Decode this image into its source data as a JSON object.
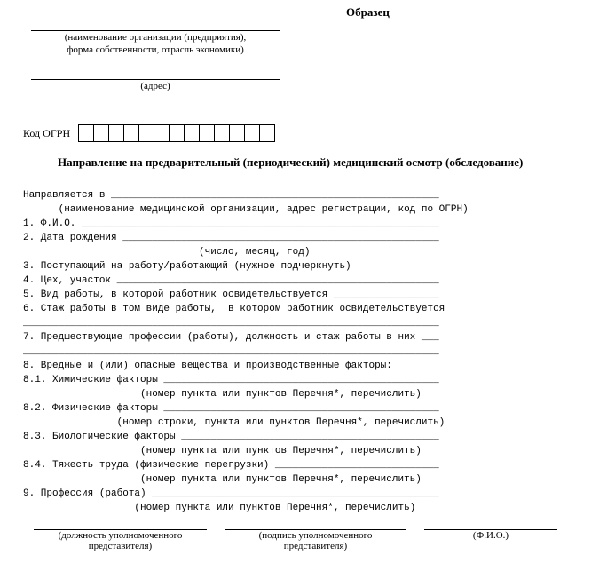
{
  "header": {
    "sample": "Образец",
    "org_caption1": "(наименование организации (предприятия),",
    "org_caption2": "форма собственности, отрасль экономики)",
    "addr_caption": "(адрес)"
  },
  "ogrn": {
    "label": "Код ОГРН",
    "cell_count": 13
  },
  "title": "Направление на предварительный (периодический) медицинский осмотр (обследование)",
  "body": "Направляется в ________________________________________________________\n      (наименование медицинской организации, адрес регистрации, код по ОГРН)\n1. Ф.И.О. _____________________________________________________________\n2. Дата рождения ______________________________________________________\n                              (число, месяц, год)\n3. Поступающий на работу/работающий (нужное подчеркнуть)\n4. Цех, участок _______________________________________________________\n5. Вид работы, в которой работник освидетельствуется __________________\n6. Стаж работы в том виде работы,  в котором работник освидетельствуется\n_______________________________________________________________________\n7. Предшествующие профессии (работы), должность и стаж работы в них ___\n_______________________________________________________________________\n8. Вредные и (или) опасные вещества и производственные факторы:\n8.1. Химические факторы _______________________________________________\n                    (номер пункта или пунктов Перечня*, перечислить)\n8.2. Физические факторы _______________________________________________\n                (номер строки, пункта или пунктов Перечня*, перечислить)\n8.3. Биологические факторы ____________________________________________\n                    (номер пункта или пунктов Перечня*, перечислить)\n8.4. Тяжесть труда (физические перегрузки) ____________________________\n                    (номер пункта или пунктов Перечня*, перечислить)\n9. Профессия (работа) _________________________________________________\n                   (номер пункта или пунктов Перечня*, перечислить)",
  "footer": {
    "col1a": "(должность уполномоченного",
    "col1b": "представителя)",
    "col2a": "(подпись уполномоченного",
    "col2b": "представителя)",
    "col3": "(Ф.И.О.)"
  }
}
